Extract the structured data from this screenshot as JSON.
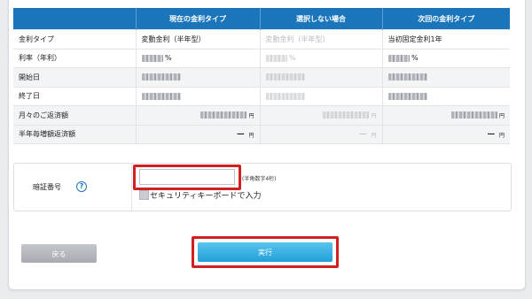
{
  "table": {
    "headers": [
      "",
      "現在の金利タイプ",
      "選択しない場合",
      "次回の金利タイプ"
    ],
    "rows": [
      {
        "label": "金利タイプ",
        "current": "変動金利（半年型）",
        "not_selected": "変動金利（半年型）",
        "next": "当初固定金利1年"
      },
      {
        "label": "利率（年利）",
        "current_unit": "%",
        "not_selected_unit": "%",
        "next_unit": "%"
      },
      {
        "label": "開始日"
      },
      {
        "label": "終了日"
      },
      {
        "label": "月々のご返済額",
        "current_unit": "円",
        "not_selected_unit": "円",
        "next_unit": "円"
      },
      {
        "label": "半年毎増額返済額",
        "current": "ー",
        "current_unit": "円",
        "not_selected": "ー",
        "not_selected_unit": "円",
        "next": "ー",
        "next_unit": "円"
      }
    ]
  },
  "pin": {
    "label": "暗証番号",
    "help_icon": "?",
    "input_value": "",
    "hint": "(半角数字4桁)",
    "keyboard_label": "セキュリティキーボードで入力"
  },
  "buttons": {
    "back": "戻る",
    "execute": "実行"
  },
  "colors": {
    "header_blue": "#1b75bb",
    "highlight_red": "#d21f1f",
    "execute_blue": "#22a0d8"
  }
}
